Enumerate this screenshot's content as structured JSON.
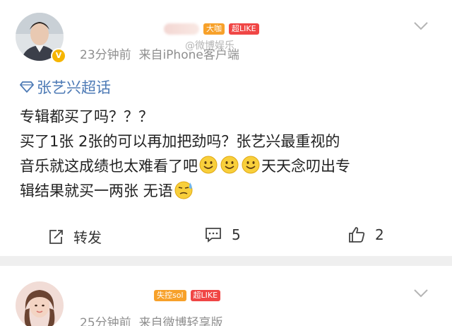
{
  "post1": {
    "tags": [
      "大咖",
      "超LIKE"
    ],
    "timestamp": "23分钟前",
    "source": "来自iPhone客户端",
    "watermark": "@微博娱乐",
    "topic": "张艺兴超话",
    "lines": [
      "专辑都买了吗？？？",
      "买了1张 2张的可以再加把劲吗？张艺兴最重视的",
      "音乐就这成绩也太难看了吧",
      "天天念叨出专",
      "辑结果就买一两张 无语"
    ],
    "actions": {
      "repost_label": "转发",
      "comment_count": "5",
      "like_count": "2"
    }
  },
  "post2": {
    "tags": [
      "失控sol",
      "超LIKE"
    ],
    "timestamp": "25分钟前",
    "source": "来自微博轻享版"
  },
  "colors": {
    "topic_blue": "#4d7ab5",
    "tag_orange": "#f7a12a",
    "tag_red": "#f04645",
    "meta_gray": "#8f8f8f",
    "separator": "#efefef"
  },
  "icons": [
    "chevron-down-icon",
    "verified-badge-icon",
    "diamond-icon",
    "smile-emoji-icon",
    "sweat-emoji-icon",
    "repost-icon",
    "comment-icon",
    "like-icon"
  ]
}
